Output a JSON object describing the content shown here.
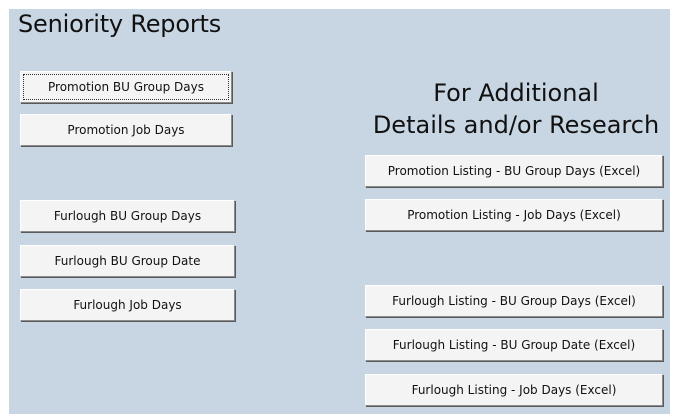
{
  "window": {
    "title": "Seniority Reports",
    "subtitle_line1": "For Additional",
    "subtitle_line2": "Details and/or Research"
  },
  "reports": {
    "promotion_bu_group_days": "Promotion BU Group Days",
    "promotion_job_days": "Promotion Job Days",
    "furlough_bu_group_days": "Furlough BU Group Days",
    "furlough_bu_group_date": "Furlough BU Group Date",
    "furlough_job_days": "Furlough Job Days"
  },
  "listings": {
    "promotion_bu_group_days": "Promotion Listing - BU Group Days (Excel)",
    "promotion_job_days": "Promotion Listing - Job Days (Excel)",
    "furlough_bu_group_days": "Furlough Listing - BU Group Days (Excel)",
    "furlough_bu_group_date": "Furlough Listing - BU Group Date (Excel)",
    "furlough_job_days": "Furlough Listing - Job Days (Excel)"
  },
  "colors": {
    "panel_background": "#c8d6e4",
    "button_face": "#f4f4f4"
  }
}
